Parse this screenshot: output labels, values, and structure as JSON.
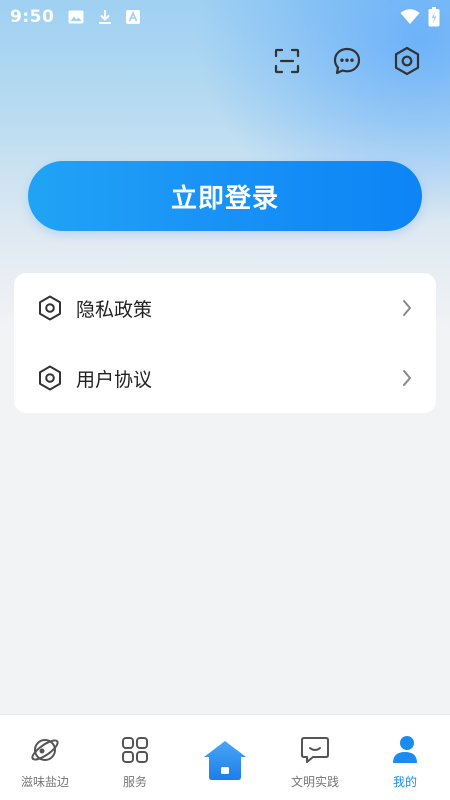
{
  "status_bar": {
    "time": "9:50",
    "left_icons": [
      "image-icon",
      "download-icon",
      "font-a-icon"
    ],
    "right_icons": [
      "wifi-icon",
      "battery-charging-icon"
    ]
  },
  "header": {
    "actions": [
      {
        "name": "scan-icon",
        "label": "scan"
      },
      {
        "name": "message-icon",
        "label": "messages"
      },
      {
        "name": "settings-icon",
        "label": "settings"
      }
    ]
  },
  "login": {
    "label": "立即登录"
  },
  "menu": {
    "items": [
      {
        "label": "隐私政策",
        "icon": "hexagon-gear-icon"
      },
      {
        "label": "用户协议",
        "icon": "hexagon-gear-icon"
      }
    ]
  },
  "bottom_nav": {
    "items": [
      {
        "label": "滋味盐边",
        "icon": "planet-icon",
        "active": false
      },
      {
        "label": "服务",
        "icon": "grid-icon",
        "active": false
      },
      {
        "label": "",
        "icon": "home-icon",
        "active": false
      },
      {
        "label": "文明实践",
        "icon": "chat-smile-icon",
        "active": false
      },
      {
        "label": "我的",
        "icon": "user-icon",
        "active": true
      }
    ]
  },
  "colors": {
    "accent": "#1a8cf0",
    "button_start": "#21a3f5",
    "button_end": "#0d84f6",
    "background": "#f2f3f5"
  }
}
